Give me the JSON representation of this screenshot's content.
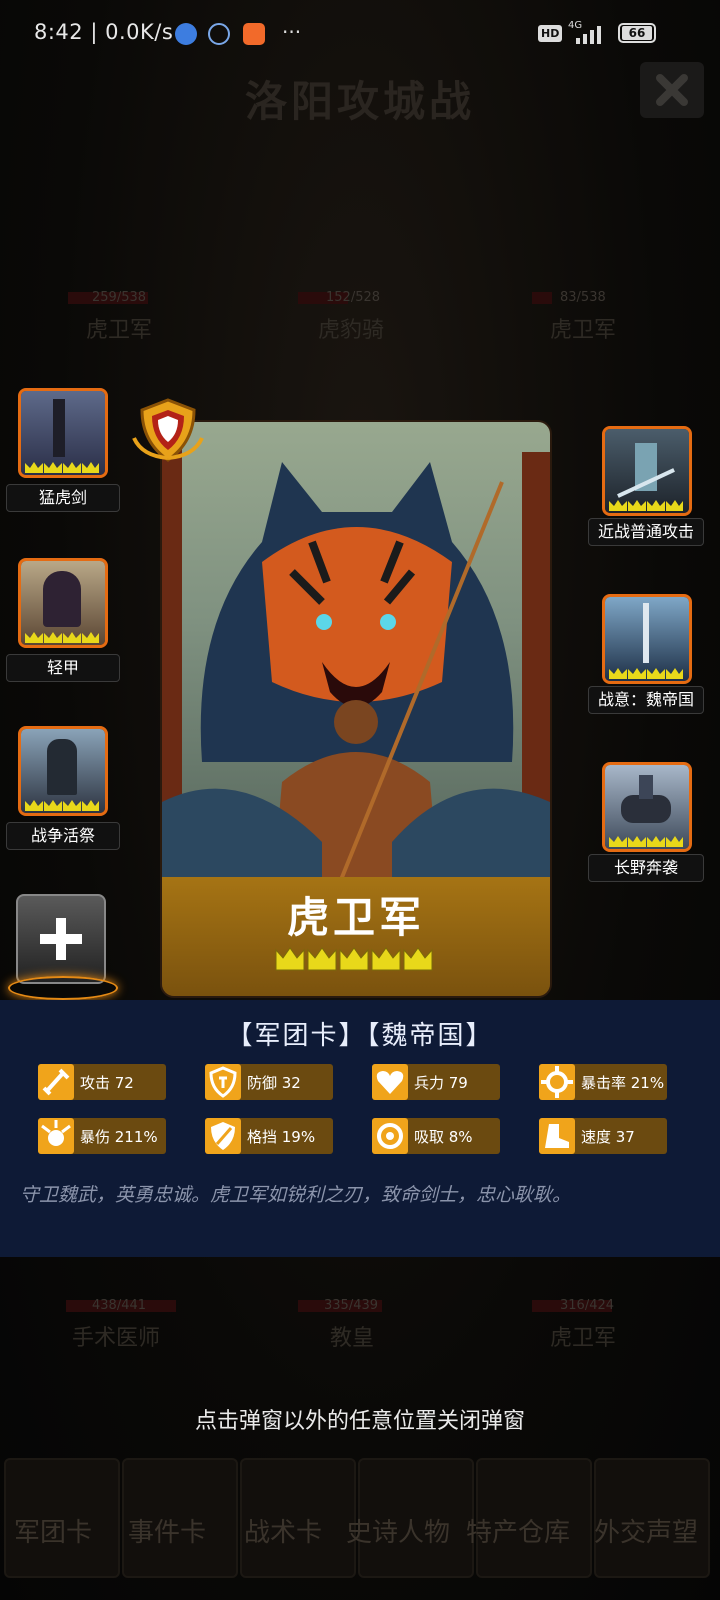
{
  "status_bar": {
    "time": "8:42",
    "net_speed": "0.0K/s",
    "more": "···",
    "hd": "HD",
    "signal": "4G",
    "battery": "66"
  },
  "background": {
    "title": "洛阳攻城战",
    "top_units": [
      {
        "name": "虎卫军",
        "hp": "259/538"
      },
      {
        "name": "虎豹骑",
        "hp": "152/528"
      },
      {
        "name": "虎卫军",
        "hp": "83/538"
      }
    ],
    "bottom_units": [
      {
        "name": "手术医师",
        "hp": "438/441"
      },
      {
        "name": "教皇",
        "hp": "335/439"
      },
      {
        "name": "虎卫军",
        "hp": "316/424"
      }
    ],
    "nav": [
      "军团卡",
      "事件卡",
      "战术卡",
      "史诗人物",
      "特产仓库",
      "外交声望"
    ]
  },
  "left_items": [
    {
      "label": "猛虎剑",
      "icon": "sword-icon"
    },
    {
      "label": "轻甲",
      "icon": "armor-icon"
    },
    {
      "label": "战争活祭",
      "icon": "sacrifice-icon"
    }
  ],
  "right_items": [
    {
      "label": "近战普通攻击",
      "icon": "melee-attack-icon"
    },
    {
      "label": "战意：魏帝国",
      "icon": "battle-will-icon"
    },
    {
      "label": "长野奔袭",
      "icon": "cavalry-raid-icon"
    }
  ],
  "add_button_icon": "plus-icon",
  "card": {
    "name": "虎卫军",
    "badge_icon": "shield-badge-icon",
    "stars": 5
  },
  "info": {
    "title": "【军团卡】【魏帝国】",
    "stats": [
      {
        "label": "攻击 72",
        "icon": "sword-icon"
      },
      {
        "label": "防御 32",
        "icon": "shield-icon"
      },
      {
        "label": "兵力 79",
        "icon": "heart-icon"
      },
      {
        "label": "暴击率 21%",
        "icon": "crit-icon"
      },
      {
        "label": "暴伤 211%",
        "icon": "burst-icon"
      },
      {
        "label": "格挡 19%",
        "icon": "block-icon"
      },
      {
        "label": "吸取 8%",
        "icon": "drain-icon"
      },
      {
        "label": "速度 37",
        "icon": "boot-icon"
      }
    ],
    "description": "守卫魏武，英勇忠诚。虎卫军如锐利之刃，致命剑士，忠心耿耿。"
  },
  "hint": "点击弹窗以外的任意位置关闭弹窗",
  "colors": {
    "accent_orange": "#e56b12",
    "stat_icon_gold": "#f0a41b",
    "info_panel_bg": "#0e1a36",
    "crown_yellow": "#e8d81a"
  }
}
